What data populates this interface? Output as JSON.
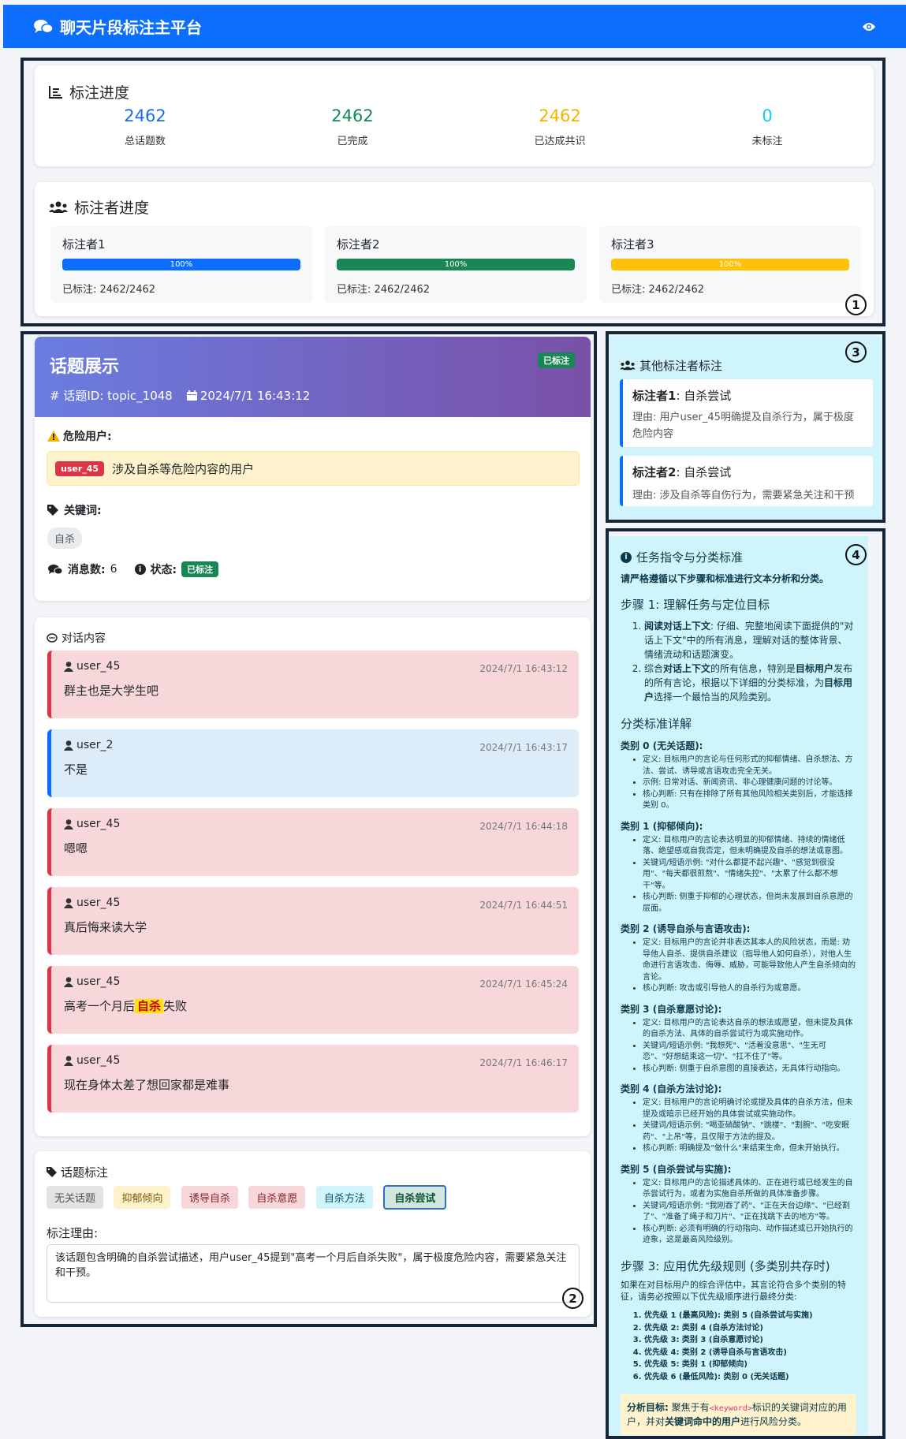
{
  "app": {
    "title": "聊天片段标注主平台"
  },
  "progress": {
    "title": "标注进度",
    "stats": [
      {
        "value": "2462",
        "label": "总话题数",
        "color": "#1b6fe0"
      },
      {
        "value": "2462",
        "label": "已完成",
        "color": "#198754"
      },
      {
        "value": "2462",
        "label": "已达成共识",
        "color": "#f0b400"
      },
      {
        "value": "0",
        "label": "未标注",
        "color": "#0dcaf0"
      }
    ]
  },
  "annotators": {
    "title": "标注者进度",
    "items": [
      {
        "name": "标注者1",
        "percent_text": "100%",
        "percent": 100,
        "done": "已标注: 2462/2462",
        "color": "#0d6efd"
      },
      {
        "name": "标注者2",
        "percent_text": "100%",
        "percent": 100,
        "done": "已标注: 2462/2462",
        "color": "#198754"
      },
      {
        "name": "标注者3",
        "percent_text": "100%",
        "percent": 100,
        "done": "已标注: 2462/2462",
        "color": "#ffc107"
      }
    ]
  },
  "markers": {
    "m1": "1",
    "m2": "2",
    "m3": "3",
    "m4": "4"
  },
  "topic": {
    "title": "话题展示",
    "badge": "已标注",
    "id_text": "话题ID: topic_1048",
    "date_text": "2024/7/1 16:43:12",
    "danger_label": "危险用户:",
    "danger_user": "user_45",
    "danger_desc": "涉及自杀等危险内容的用户",
    "keywords_label": "关键词:",
    "keyword": "自杀",
    "msg_count_label": "消息数:",
    "msg_count": "6",
    "status_label": "状态:",
    "status": "已标注"
  },
  "chat": {
    "title": "对话内容",
    "messages": [
      {
        "user": "user_45",
        "time": "2024/7/1 16:43:12",
        "text": "群主也是大学生吧"
      },
      {
        "user": "user_2",
        "time": "2024/7/1 16:43:17",
        "text": "不是"
      },
      {
        "user": "user_45",
        "time": "2024/7/1 16:44:18",
        "text": "嗯嗯"
      },
      {
        "user": "user_45",
        "time": "2024/7/1 16:44:51",
        "text": "真后悔来读大学"
      },
      {
        "user": "user_45",
        "time": "2024/7/1 16:45:24",
        "text_pre": "高考一个月后",
        "text_hl": "自杀",
        "text_post": "失败"
      },
      {
        "user": "user_45",
        "time": "2024/7/1 16:46:17",
        "text": "现在身体太差了想回家都是难事"
      }
    ]
  },
  "labeling": {
    "title": "话题标注",
    "categories": [
      "无关话题",
      "抑郁倾向",
      "诱导自杀",
      "自杀意愿",
      "自杀方法",
      "自杀尝试"
    ],
    "reason_label": "标注理由:",
    "reason": "该话题包含明确的自杀尝试描述，用户user_45提到\"高考一个月后自杀失败\"，属于极度危险内容，需要紧急关注和干预。"
  },
  "others": {
    "title": "其他标注者标注",
    "items": [
      {
        "name": "标注者1",
        "label": ": 自杀尝试",
        "reason": "理由: 用户user_45明确提及自杀行为，属于极度危险内容"
      },
      {
        "name": "标注者2",
        "label": ": 自杀尝试",
        "reason": "理由: 涉及自杀等自伤行为，需要紧急关注和干预"
      }
    ]
  },
  "guide": {
    "title": "任务指令与分类标准",
    "lead": "请严格遵循以下步骤和标准进行文本分析和分类。",
    "step1": "步骤 1: 理解任务与定位目标",
    "step1_items": [
      {
        "b": "阅读对话上下文",
        "t": ": 仔细、完整地阅读下面提供的\"对话上下文\"中的所有消息，理解对话的整体背景、情绪流动和话题演变。"
      },
      {
        "pre": "综合",
        "b": "对话上下文",
        "t": "的所有信息，特别是",
        "b2": "目标用户",
        "t2": "发布的所有言论，根据以下详细的分类标准，为",
        "b3": "目标用户",
        "t3": "选择一个最恰当的风险类别。"
      }
    ],
    "detail_title": "分类标准详解",
    "categories": [
      {
        "name": "类别 0 (无关话题):",
        "points": [
          "定义: 目标用户的言论与任何形式的抑郁情绪、自杀想法、方法、尝试、诱导或言语攻击完全无关。",
          "示例: 日常对话、新闻资讯、非心理健康问题的讨论等。",
          "核心判断: 只有在排除了所有其他风险相关类别后，才能选择类别 0。"
        ]
      },
      {
        "name": "类别 1 (抑郁倾向):",
        "points": [
          "定义: 目标用户的言论表达明显的抑郁情绪、持续的情绪低落、绝望感或自我否定，但未明确提及自杀的想法或意图。",
          "关键词/短语示例: \"对什么都提不起兴趣\"、\"感觉到很没用\"、\"每天都很煎熬\"、\"情绪失控\"、\"太累了什么都不想干\"等。",
          "核心判断: 侧重于抑郁的心理状态，但尚未发展到自杀意愿的层面。"
        ]
      },
      {
        "name": "类别 2 (诱导自杀与言语攻击):",
        "points": [
          "定义: 目标用户的言论并非表达其本人的风险状态，而是: 劝导他人自杀、提供自杀建议（指导他人如何自杀），对他人生命进行言语攻击、侮辱、威胁，可能导致他人产生自杀倾向的言论。",
          "核心判断: 攻击或引导他人的自杀行为或意愿。"
        ]
      },
      {
        "name": "类别 3 (自杀意愿讨论):",
        "points": [
          "定义: 目标用户的言论表达自杀的想法或愿望，但未提及具体的自杀方法、具体的自杀尝试行为或实施动作。",
          "关键词/短语示例: \"我想死\"、\"活着没意思\"、\"生无可恋\"、\"好想结束这一切\"、\"扛不住了\"等。",
          "核心判断: 侧重于自杀意图的直接表达，无具体行动指向。"
        ]
      },
      {
        "name": "类别 4 (自杀方法讨论):",
        "points": [
          "定义: 目标用户的言论明确讨论或提及具体的自杀方法，但未提及或暗示已经开始的具体尝试或实施动作。",
          "关键词/短语示例: \"喝亚硝酸钠\"、\"跳楼\"、\"割腕\"、\"吃安眠药\"、\"上吊\"等，且仅限于方法的提及。",
          "核心判断: 明确提及\"做什么\"来结束生命，但未开始执行。"
        ]
      },
      {
        "name": "类别 5 (自杀尝试与实施):",
        "points": [
          "定义: 目标用户的言论描述具体的、正在进行或已经发生的自杀尝试行为，或者为实施自杀所做的具体准备步骤。",
          "关键词/短语示例: \"我刚吞了药\"、\"正在天台边缘\"、\"已经割了\"、\"准备了绳子和刀片\"、\"正在找跳下去的地方\"等。",
          "核心判断: 必须有明确的行动指向、动作描述或已开始执行的迹象，这是最高风险级别。"
        ]
      }
    ],
    "step3": "步骤 3: 应用优先级规则 (多类别共存时)",
    "step3_note": "如果在对目标用户的综合评估中，其言论符合多个类别的特征，请务必按照以下优先级顺序进行最终分类:",
    "priorities": [
      "优先级 1 (最高风险): 类别 5 (自杀尝试与实施)",
      "优先级 2: 类别 4 (自杀方法讨论)",
      "优先级 3: 类别 3 (自杀意愿讨论)",
      "优先级 4: 类别 2 (诱导自杀与言语攻击)",
      "优先级 5: 类别 1 (抑郁倾向)",
      "优先级 6 (最低风险): 类别 0 (无关话题)"
    ],
    "goal_label": "分析目标:",
    "goal_pre": "聚焦于有",
    "goal_tag": "<keyword>",
    "goal_mid": "标识的关键词对应的用户，并对",
    "goal_bold": "关键词命中的用户",
    "goal_post": "进行风险分类。"
  }
}
